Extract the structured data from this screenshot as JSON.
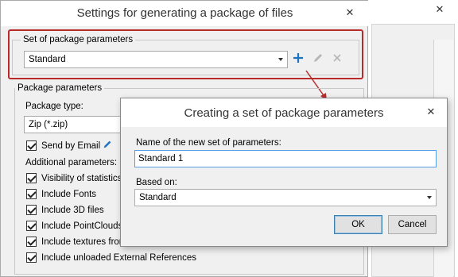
{
  "main_dialog": {
    "title": "Settings for generating a package of files",
    "package_set_group": {
      "label": "Set of package parameters",
      "selected": "Standard"
    },
    "package_params_group": {
      "label": "Package parameters",
      "package_type_label": "Package type:",
      "package_type_value": "Zip (*.zip)",
      "send_by_email_label": "Send by Email",
      "additional_label": "Additional parameters:",
      "options": [
        "Visibility of statistics",
        "Include Fonts",
        "Include 3D files",
        "Include PointClouds",
        "Include textures from",
        "Include unloaded External References"
      ]
    },
    "icons": [
      "add-icon",
      "edit-pencil-icon",
      "delete-x-icon",
      "close-icon"
    ],
    "highlight_color": "#b92b2b",
    "accent_color": "#1e73be"
  },
  "popup_dialog": {
    "title": "Creating a set of package parameters",
    "name_label": "Name of the new set of parameters:",
    "name_value": "Standard 1",
    "based_on_label": "Based on:",
    "based_on_value": "Standard",
    "ok_label": "OK",
    "cancel_label": "Cancel"
  }
}
